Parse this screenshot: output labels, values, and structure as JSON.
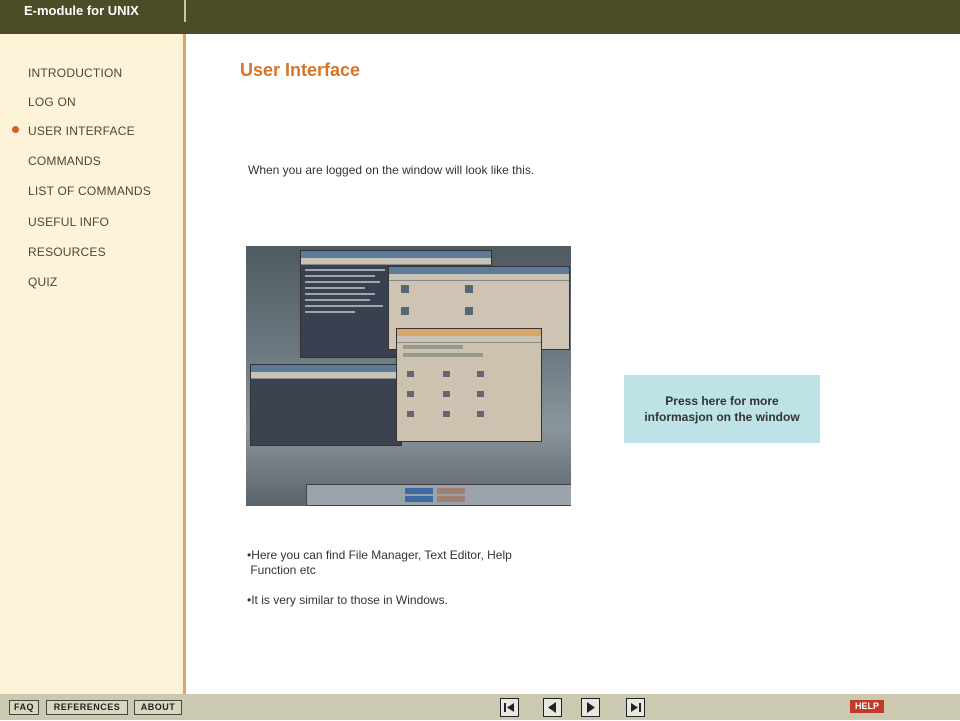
{
  "app": {
    "title": "E-module for UNIX"
  },
  "sidebar": {
    "items": [
      {
        "label": "INTRODUCTION"
      },
      {
        "label": "LOG ON"
      },
      {
        "label": "USER INTERFACE",
        "active": true
      },
      {
        "label": "COMMANDS"
      },
      {
        "label": "LIST OF COMMANDS"
      },
      {
        "label": "USEFUL INFO"
      },
      {
        "label": "RESOURCES"
      },
      {
        "label": "QUIZ"
      }
    ]
  },
  "main": {
    "title": "User Interface",
    "intro": "When you are logged on the window will look like this.",
    "more_button": "Press here for more informasjon on the window",
    "bullets": [
      "•Here you can find File Manager, Text Editor, Help",
      " Function etc",
      "•It is very similar to those in Windows."
    ]
  },
  "bottom": {
    "faq": "FAQ",
    "references": "REFERENCES",
    "about": "ABOUT",
    "help": "HELP"
  },
  "colors": {
    "topbar": "#4a4d26",
    "accent": "#d8742a",
    "sidebar_bg": "#fdf3d8",
    "info_box": "#bde3e6"
  }
}
